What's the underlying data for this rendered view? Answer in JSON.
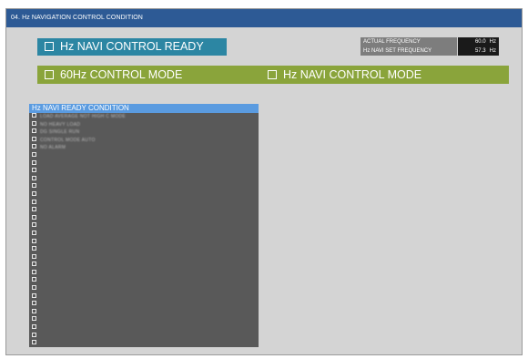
{
  "window": {
    "title": "04. Hz NAVIGATION CONTROL CONDITION"
  },
  "status": {
    "ready_label": "Hz NAVI CONTROL READY",
    "mode_60_label": "60Hz CONTROL MODE",
    "mode_navi_label": "Hz NAVI CONTROL MODE"
  },
  "frequency": {
    "actual_label": "ACTUAL FREQUENCY",
    "actual_value": "60.0",
    "actual_unit": "Hz",
    "set_label": "Hz NAVI SET FREQUENCY",
    "set_value": "57.3",
    "set_unit": "Hz"
  },
  "conditions": {
    "header": "Hz NAVI READY CONDITION",
    "items": [
      "LOAD AVERAGE NOT HIGH C MODE",
      "NO HEAVY LOAD",
      "DG SINGLE RUN",
      "CONTROL MODE AUTO",
      "NO ALARM",
      "",
      "",
      "",
      "",
      "",
      "",
      "",
      "",
      "",
      "",
      "",
      "",
      "",
      "",
      "",
      "",
      "",
      "",
      "",
      "",
      "",
      "",
      "",
      "",
      ""
    ]
  },
  "colors": {
    "title_bar": "#2d5a95",
    "ready_box": "#2c86a3",
    "mode_bar": "#8aa43b",
    "panel_bg": "#595959",
    "panel_header": "#5a9be0"
  }
}
